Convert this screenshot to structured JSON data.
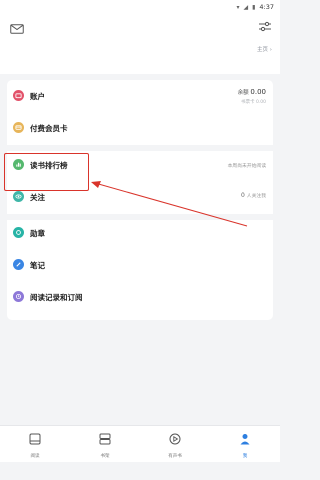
{
  "status_bar": {
    "time": "4:37"
  },
  "header": {
    "homepage_link": "主页 ›"
  },
  "menu": {
    "account": {
      "label": "账户",
      "balance": "余额",
      "balance_value": "0.00",
      "sub": "书票卡 0.00"
    },
    "vip": {
      "label": "付费会员卡"
    },
    "ranking": {
      "label": "读书排行榜",
      "right": "本周尚未开始阅读"
    },
    "follow": {
      "label": "关注",
      "count": "0",
      "right": "人关注我"
    },
    "badge": {
      "label": "勋章"
    },
    "notes": {
      "label": "笔记"
    },
    "history": {
      "label": "阅读记录和订阅"
    }
  },
  "tabs": [
    {
      "label": "阅读",
      "icon": "book-icon",
      "active": false
    },
    {
      "label": "书架",
      "icon": "bookshelf-icon",
      "active": false
    },
    {
      "label": "有声书",
      "icon": "play-icon",
      "active": false
    },
    {
      "label": "我",
      "icon": "person-icon",
      "active": true
    }
  ],
  "colors": {
    "account": "#e2526a",
    "vip": "#e7b55a",
    "ranking": "#55b86e",
    "follow": "#3fb6a8",
    "badge": "#27b4a6",
    "notes": "#3a86e4",
    "history": "#8d78d8",
    "annotation": "#d9342b",
    "active_tab": "#2d7fe0"
  }
}
